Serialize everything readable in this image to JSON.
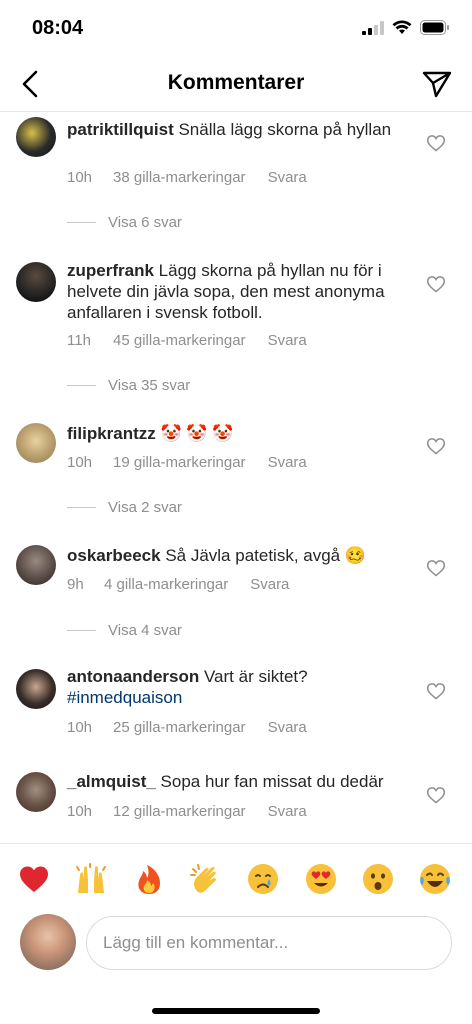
{
  "status": {
    "time": "08:04",
    "signal_icon": "signal-icon",
    "wifi_icon": "wifi-icon",
    "battery_icon": "battery-icon"
  },
  "nav": {
    "title": "Kommentarer",
    "back_icon": "back-arrow-icon",
    "send_icon": "send-icon"
  },
  "comments": [
    {
      "user": "patriktillquist",
      "text": "Snälla lägg skorna på hyllan",
      "time": "10h",
      "likes": "38 gilla-markeringar",
      "reply": "Svara",
      "view_replies": "Visa 6 svar"
    },
    {
      "user": "zuperfrank",
      "text": "Lägg skorna på hyllan nu för i helvete din jävla sopa, den mest anonyma anfallaren i svensk fotboll.",
      "time": "11h",
      "likes": "45 gilla-markeringar",
      "reply": "Svara",
      "view_replies": "Visa 35 svar"
    },
    {
      "user": "filipkrantzz",
      "text": "🤡 🤡 🤡",
      "time": "10h",
      "likes": "19 gilla-markeringar",
      "reply": "Svara",
      "view_replies": "Visa 2 svar"
    },
    {
      "user": "oskarbeeck",
      "text": "Så Jävla patetisk, avgå 🥴",
      "time": "9h",
      "likes": "4 gilla-markeringar",
      "reply": "Svara",
      "view_replies": "Visa 4 svar"
    },
    {
      "user": "antonaanderson",
      "text": "Vart är siktet?",
      "hashtag": "#inmedquaison",
      "time": "10h",
      "likes": "25 gilla-markeringar",
      "reply": "Svara"
    },
    {
      "user": "_almquist_",
      "text": "Sopa hur fan missat du dedär",
      "time": "10h",
      "likes": "12 gilla-markeringar",
      "reply": "Svara"
    }
  ],
  "emoji_bar": [
    "❤️",
    "🙌",
    "🔥",
    "👏",
    "😢",
    "😍",
    "😮",
    "😂"
  ],
  "composer": {
    "placeholder": "Lägg till en kommentar..."
  },
  "colors": {
    "meta": "#8e8e8e",
    "hashtag": "#00376b",
    "text": "#262626"
  }
}
